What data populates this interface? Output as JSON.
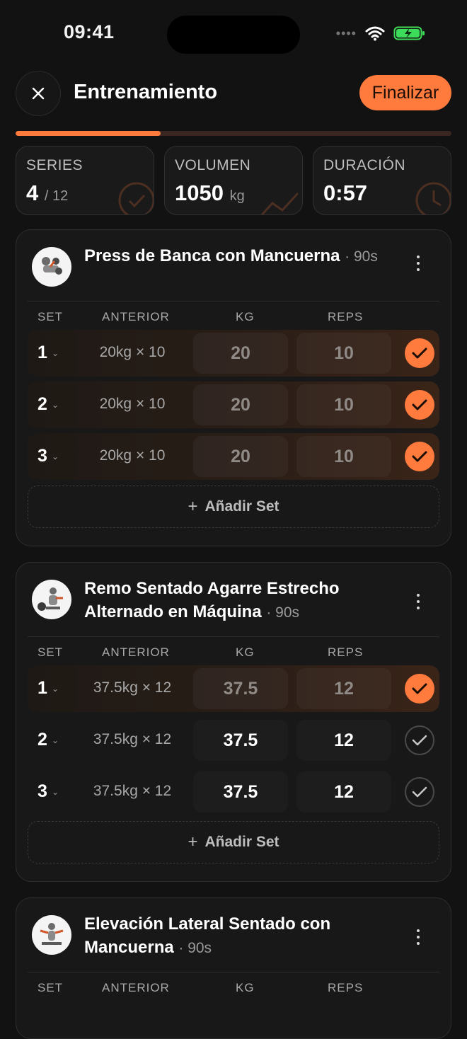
{
  "status": {
    "time": "09:41"
  },
  "header": {
    "title": "Entrenamiento",
    "finish_label": "Finalizar"
  },
  "progress": {
    "completed_fraction": 0.333
  },
  "stats": {
    "series": {
      "label": "SERIES",
      "value": "4",
      "total": "/ 12"
    },
    "volume": {
      "label": "VOLUMEN",
      "value": "1050",
      "unit": "kg"
    },
    "duration": {
      "label": "DURACIÓN",
      "value": "0:57"
    }
  },
  "columns": {
    "set": "SET",
    "prev": "ANTERIOR",
    "kg": "KG",
    "reps": "REPS"
  },
  "add_set_label": "Añadir Set",
  "exercises": [
    {
      "name": "Press de Banca con Mancuerna",
      "rest": "· 90s",
      "sets": [
        {
          "num": "1",
          "prev": "20kg × 10",
          "kg": "20",
          "reps": "10",
          "done": true
        },
        {
          "num": "2",
          "prev": "20kg × 10",
          "kg": "20",
          "reps": "10",
          "done": true
        },
        {
          "num": "3",
          "prev": "20kg × 10",
          "kg": "20",
          "reps": "10",
          "done": true
        }
      ]
    },
    {
      "name": "Remo Sentado Agarre Estrecho Alternado en Máquina",
      "rest": "· 90s",
      "sets": [
        {
          "num": "1",
          "prev": "37.5kg × 12",
          "kg": "37.5",
          "reps": "12",
          "done": true
        },
        {
          "num": "2",
          "prev": "37.5kg × 12",
          "kg": "37.5",
          "reps": "12",
          "done": false
        },
        {
          "num": "3",
          "prev": "37.5kg × 12",
          "kg": "37.5",
          "reps": "12",
          "done": false
        }
      ]
    },
    {
      "name": "Elevación Lateral Sentado con Mancuerna",
      "rest": "· 90s",
      "sets": []
    }
  ],
  "colors": {
    "accent": "#ff7a3d",
    "background": "#121212",
    "card": "#181818"
  }
}
